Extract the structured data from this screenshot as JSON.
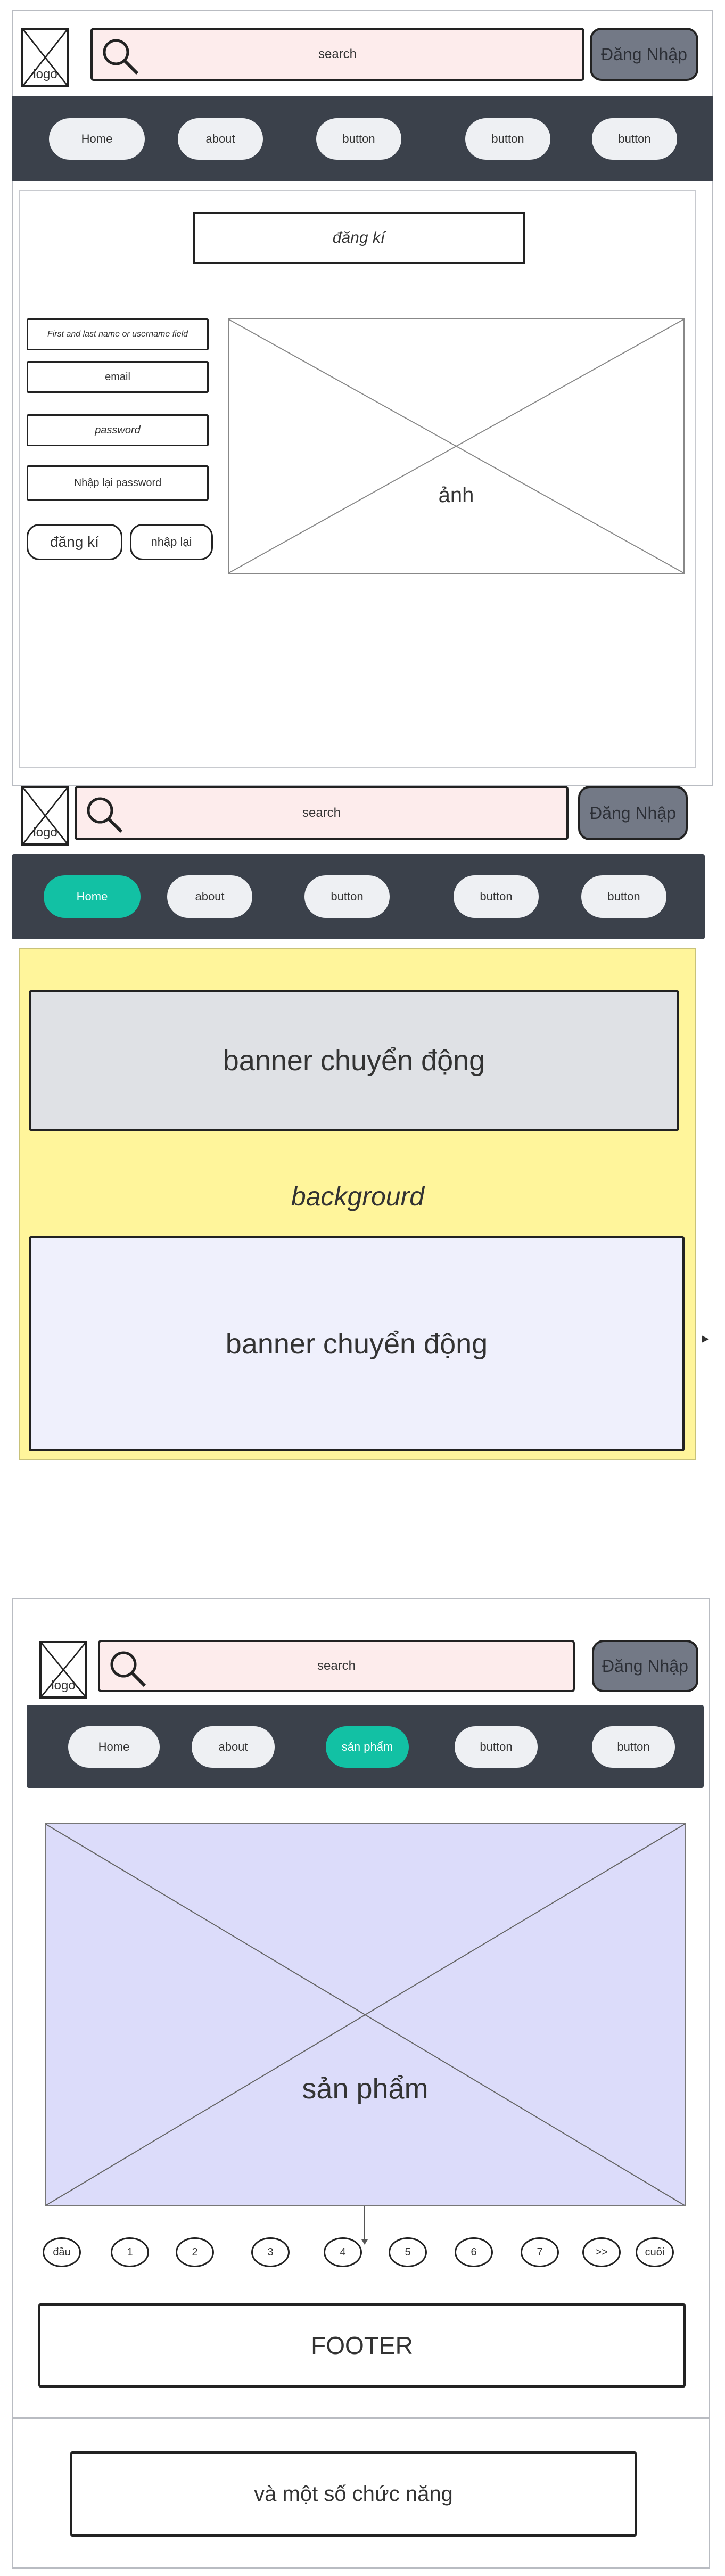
{
  "screen1": {
    "logo": "logo",
    "search": "search",
    "login": "Đăng Nhập",
    "nav": [
      "Home",
      "about",
      "button",
      "button",
      "button"
    ],
    "register_title": "đăng kí",
    "fields": [
      "First and last name or username field",
      "email",
      "password",
      "Nhập lại password"
    ],
    "register_button": "đăng kí",
    "reset_button": "nhập lại",
    "image_label": "ảnh"
  },
  "screen2": {
    "logo": "logo",
    "search": "search",
    "login": "Đăng Nhập",
    "nav": [
      "Home",
      "about",
      "button",
      "button",
      "button"
    ],
    "active_nav": "Home",
    "banner_top": "banner chuyển động",
    "background_label": "backgrourd",
    "banner_bottom": "banner chuyển động"
  },
  "screen3": {
    "logo": "logo",
    "search": "search",
    "login": "Đăng Nhập",
    "nav": [
      "Home",
      "about",
      "sản phẩm",
      "button",
      "button"
    ],
    "active_nav": "sản phẩm",
    "product_label": "sản phẩm",
    "pagination": [
      "đầu",
      "1",
      "2",
      "3",
      "4",
      "5",
      "6",
      "7",
      ">>",
      "cuối"
    ],
    "footer": "FOOTER"
  },
  "extra": "và một số chức năng",
  "colors": {
    "nav_bar": "#3b414b",
    "active_pill": "#12c1a4",
    "search_bg": "#fdecec",
    "login_bg": "#737986",
    "yellow_bg": "#fff59b",
    "banner_gray": "#dfe1e5",
    "banner_lavender": "#eff0fc",
    "product_bg": "#dcdcfa"
  }
}
